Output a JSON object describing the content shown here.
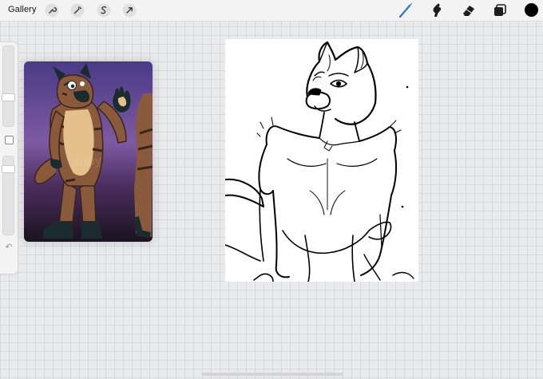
{
  "toolbar": {
    "gallery_label": "Gallery",
    "left_tools": [
      "wrench-icon",
      "magic-wand-icon",
      "selection-icon",
      "transform-arrow-icon"
    ],
    "right_tools": [
      "brush-icon",
      "smudge-icon",
      "eraser-icon",
      "layers-icon"
    ],
    "active_tool": "brush",
    "current_color": "#000000",
    "accent_color": "#2f6fe4"
  },
  "sidebar": {
    "controls": [
      "brush-size-slider",
      "modify-button",
      "opacity-slider",
      "undo-icon"
    ]
  },
  "reference_window": {
    "description_icon": "reference-image",
    "background_colors": [
      "#3b2e6a",
      "#7e5aa3",
      "#1a1320"
    ]
  },
  "canvas": {
    "background": "#ffffff",
    "ink": "#000000"
  }
}
